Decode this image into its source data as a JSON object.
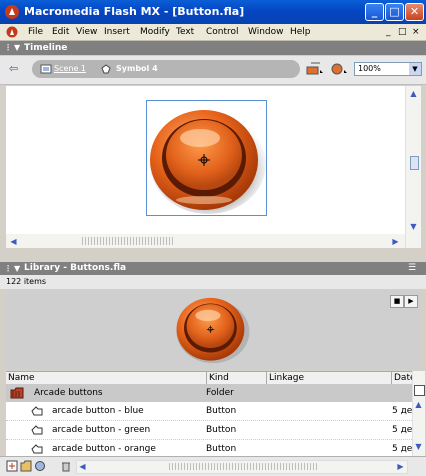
{
  "window": {
    "title": "Macromedia Flash MX - [Button.fla]",
    "minimize": "_",
    "maximize": "□",
    "close": "✕"
  },
  "menubar": {
    "items": [
      "File",
      "Edit",
      "View",
      "Insert",
      "Modify",
      "Text",
      "Control",
      "Window",
      "Help"
    ],
    "doc_controls": [
      "_",
      "□",
      "×"
    ]
  },
  "timeline": {
    "title": "Timeline",
    "breadcrumbs": [
      "Scene 1",
      "Symbol 4"
    ],
    "zoom_value": "100%"
  },
  "library": {
    "title": "Library - Buttons.fla",
    "item_count": "122 items",
    "columns": [
      "Name",
      "Kind",
      "Linkage",
      "Date"
    ],
    "rows": [
      {
        "name": "Arcade buttons",
        "kind": "Folder",
        "linkage": "",
        "date": ""
      },
      {
        "name": "arcade button - blue",
        "kind": "Button",
        "linkage": "",
        "date": "5 де"
      },
      {
        "name": "arcade button - green",
        "kind": "Button",
        "linkage": "",
        "date": "5 де"
      },
      {
        "name": "arcade button - orange",
        "kind": "Button",
        "linkage": "",
        "date": "5 де"
      }
    ]
  },
  "colors": {
    "titlebar": "#0546c4",
    "panel_header": "#808080",
    "button_orange": "#e8641b",
    "selection_frame": "#5b8fd6"
  }
}
